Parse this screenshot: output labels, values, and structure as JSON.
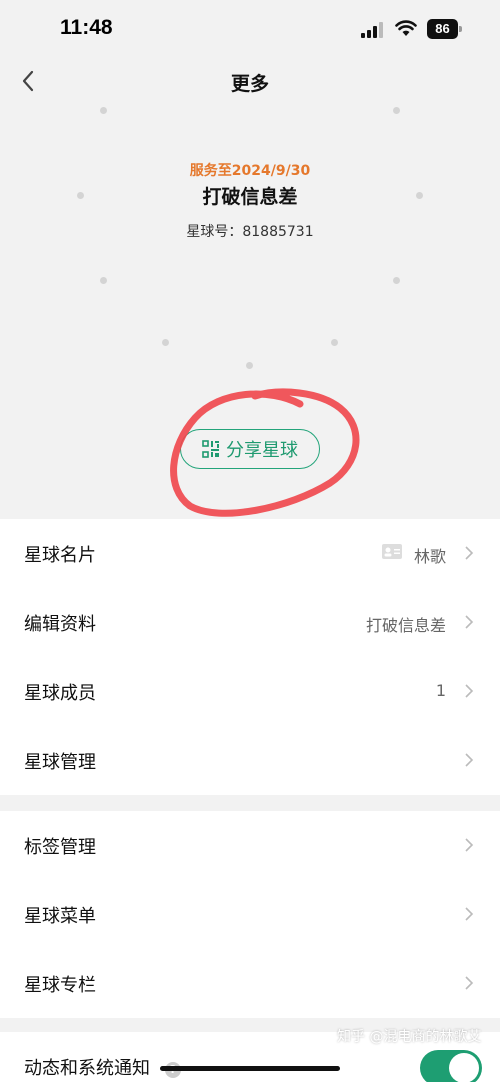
{
  "status_bar": {
    "time": "11:48",
    "battery": "86"
  },
  "nav": {
    "title": "更多"
  },
  "header": {
    "service_until": "服务至2024/9/30",
    "planet_name": "打破信息差",
    "planet_id": "星球号：81885731",
    "share_button": "分享星球"
  },
  "section1": [
    {
      "label": "星球名片",
      "value": "林歌",
      "icon": "id-card-icon"
    },
    {
      "label": "编辑资料",
      "value": "打破信息差"
    },
    {
      "label": "星球成员",
      "value": "1"
    },
    {
      "label": "星球管理",
      "value": ""
    }
  ],
  "section2": [
    {
      "label": "标签管理"
    },
    {
      "label": "星球菜单"
    },
    {
      "label": "星球专栏"
    }
  ],
  "section3": {
    "label": "动态和系统通知",
    "help": "?",
    "toggle_on": true
  },
  "watermark": "知乎 @混电商的林歌艾",
  "colors": {
    "accent_green": "#1e9e72",
    "service_orange": "#e5782c",
    "annotation_red": "#f0464b"
  }
}
